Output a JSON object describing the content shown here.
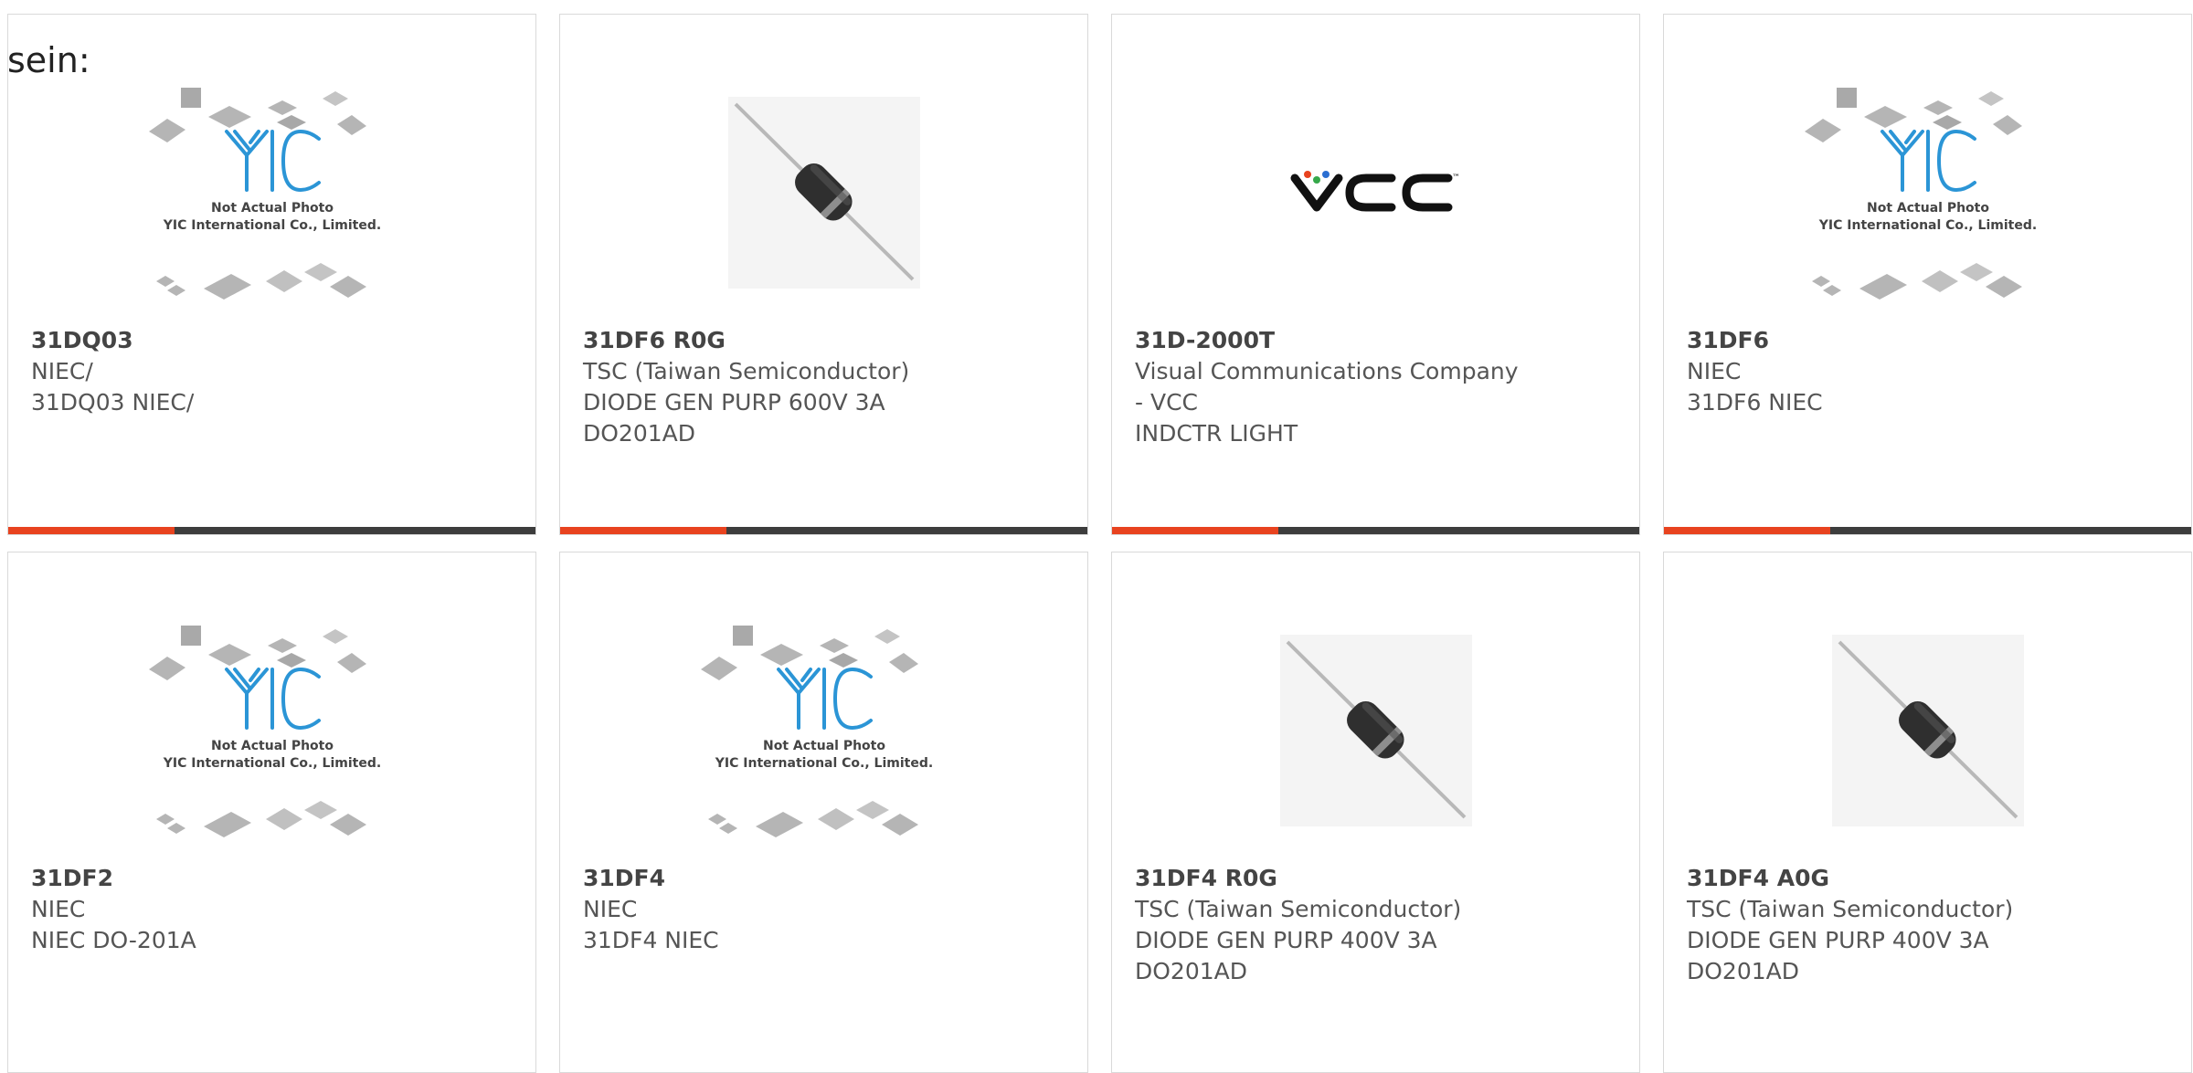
{
  "cut_text": "sein:",
  "accent_color": "#e8431f",
  "bar_color": "#3d3d3d",
  "placeholder": {
    "line1": "Not Actual Photo",
    "line2": "YIC International Co., Limited."
  },
  "vcc_logo": {
    "text": "VCC",
    "tm": "™"
  },
  "products": [
    {
      "pn": "31DQ03",
      "mfr": "NIEC/",
      "desc": [
        "31DQ03 NIEC/"
      ],
      "image": "yic-placeholder"
    },
    {
      "pn": "31DF6 R0G",
      "mfr": "TSC (Taiwan Semiconductor)",
      "desc": [
        "DIODE GEN PURP 600V 3A",
        "DO201AD"
      ],
      "image": "diode-photo"
    },
    {
      "pn": "31D-2000T",
      "mfr": "Visual Communications Company",
      "desc": [
        "- VCC",
        "INDCTR LIGHT"
      ],
      "image": "vcc-logo"
    },
    {
      "pn": "31DF6",
      "mfr": "NIEC",
      "desc": [
        "31DF6 NIEC"
      ],
      "image": "yic-placeholder"
    },
    {
      "pn": "31DF2",
      "mfr": "NIEC",
      "desc": [
        "NIEC DO-201A"
      ],
      "image": "yic-placeholder"
    },
    {
      "pn": "31DF4",
      "mfr": "NIEC",
      "desc": [
        "31DF4 NIEC"
      ],
      "image": "yic-placeholder"
    },
    {
      "pn": "31DF4 R0G",
      "mfr": "TSC (Taiwan Semiconductor)",
      "desc": [
        "DIODE GEN PURP 400V 3A",
        "DO201AD"
      ],
      "image": "diode-photo"
    },
    {
      "pn": "31DF4 A0G",
      "mfr": "TSC (Taiwan Semiconductor)",
      "desc": [
        "DIODE GEN PURP 400V 3A",
        "DO201AD"
      ],
      "image": "diode-photo"
    }
  ]
}
